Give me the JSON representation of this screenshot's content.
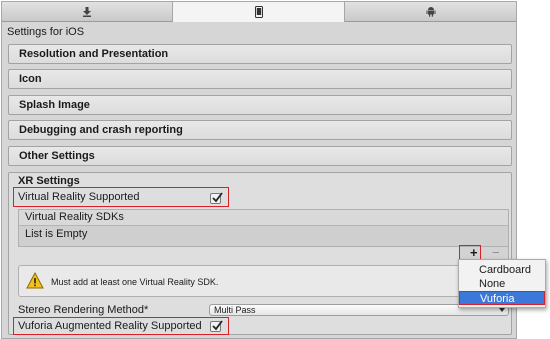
{
  "tabs": [
    {
      "icon": "download-arrow-icon"
    },
    {
      "icon": "mobile-phone-icon",
      "selected": true
    },
    {
      "icon": "android-icon"
    }
  ],
  "settings_title": "Settings for iOS",
  "sections": [
    "Resolution and Presentation",
    "Icon",
    "Splash Image",
    "Debugging and crash reporting",
    "Other Settings"
  ],
  "xr": {
    "title": "XR Settings",
    "vr_supported_label": "Virtual Reality Supported",
    "vr_supported_checked": true,
    "sdk_list_header": "Virtual Reality SDKs",
    "sdk_list_empty": "List is Empty",
    "add_symbol": "+",
    "remove_symbol": "−",
    "warning": "Must add at least one Virtual Reality SDK.",
    "stereo_label": "Stereo Rendering Method*",
    "stereo_value": "Multi Pass",
    "vuforia_label": "Vuforia Augmented Reality Supported",
    "vuforia_checked": true
  },
  "sdk_popup": {
    "items": [
      "Cardboard",
      "None",
      "Vuforia"
    ],
    "selected": "Vuforia"
  },
  "colors": {
    "highlight_border": "#d8202a",
    "selection_blue": "#3b78d8",
    "warning_yellow": "#f2c11a"
  }
}
